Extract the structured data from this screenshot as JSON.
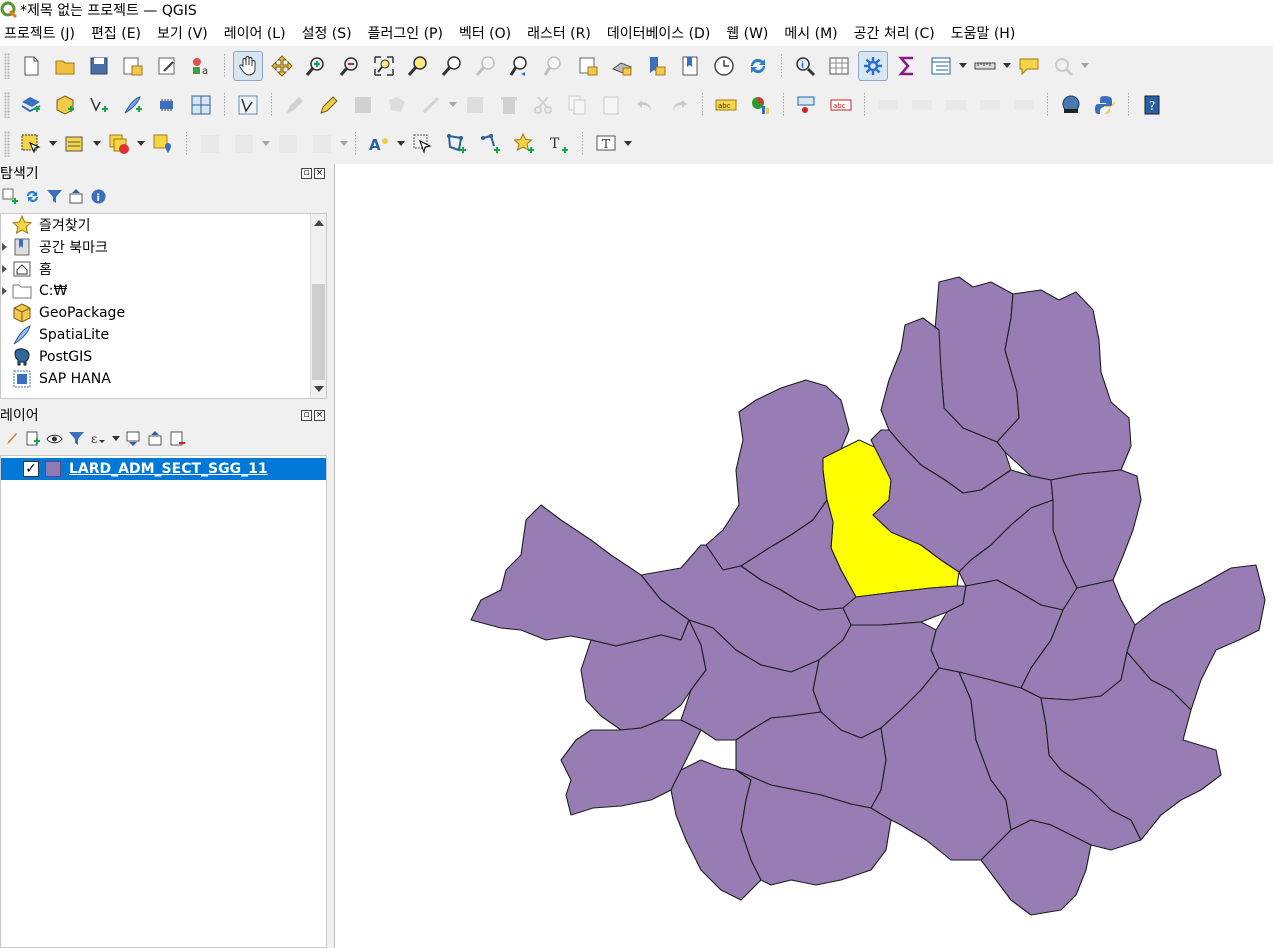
{
  "window": {
    "title": "*제목 없는 프로젝트 — QGIS"
  },
  "menu": [
    "프로젝트 (J)",
    "편집 (E)",
    "보기 (V)",
    "레이어 (L)",
    "설정 (S)",
    "플러그인 (P)",
    "벡터 (O)",
    "래스터 (R)",
    "데이터베이스 (D)",
    "웹 (W)",
    "메시 (M)",
    "공간 처리 (C)",
    "도움말 (H)"
  ],
  "browser_panel": {
    "title": "탐색기",
    "items": [
      {
        "label": "즐겨찾기",
        "icon": "star-icon",
        "expandable": false
      },
      {
        "label": "공간 북마크",
        "icon": "bookmark-icon",
        "expandable": true
      },
      {
        "label": "홈",
        "icon": "home-folder-icon",
        "expandable": true
      },
      {
        "label": "C:₩",
        "icon": "folder-icon",
        "expandable": true
      },
      {
        "label": "GeoPackage",
        "icon": "geopackage-icon",
        "expandable": false
      },
      {
        "label": "SpatiaLite",
        "icon": "spatialite-feather-icon",
        "expandable": false
      },
      {
        "label": "PostGIS",
        "icon": "postgis-elephant-icon",
        "expandable": false
      },
      {
        "label": "SAP HANA",
        "icon": "sap-hana-icon",
        "expandable": false
      }
    ]
  },
  "layers_panel": {
    "title": "레이어",
    "layers": [
      {
        "name": "LARD_ADM_SECT_SGG_11",
        "checked": true,
        "selected": true,
        "fill_color": "#8f7ab4"
      }
    ]
  },
  "map": {
    "district_fill": "#987db5",
    "district_stroke": "#1e1e1e",
    "highlight_fill": "#ffff00",
    "background": "#ffffff"
  },
  "colors": {
    "selection": "#0078d7",
    "toolbar_bg": "#f0f0f0"
  }
}
